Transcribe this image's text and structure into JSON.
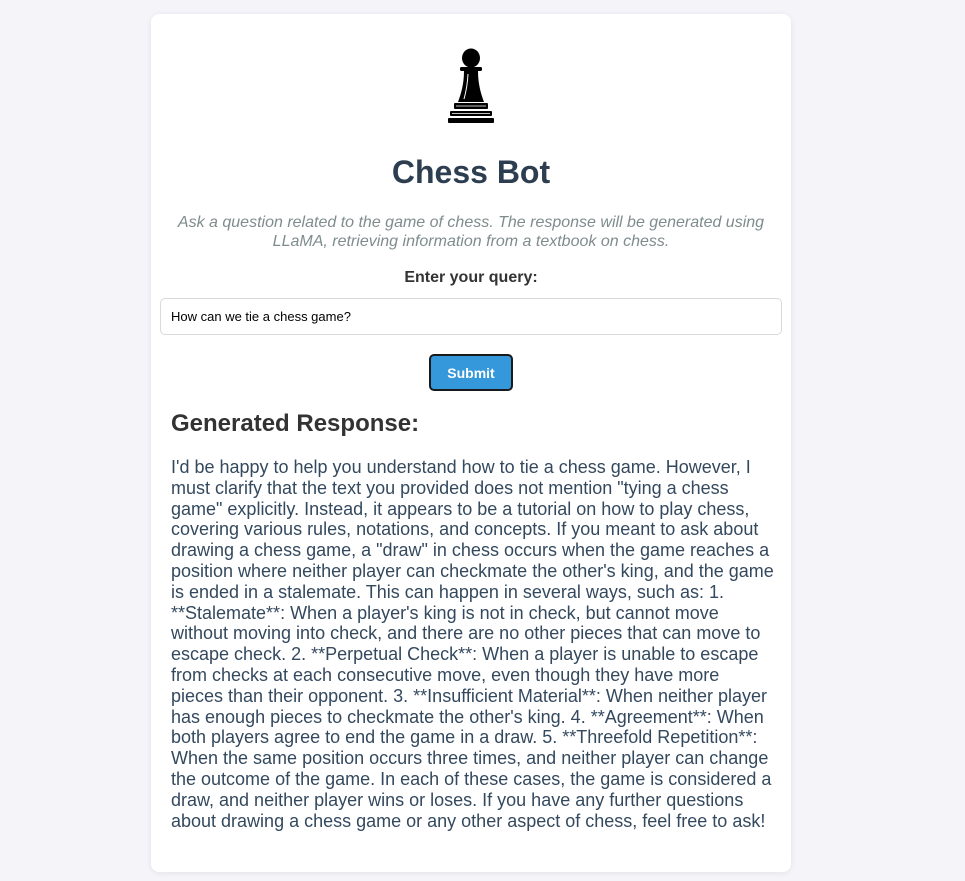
{
  "header": {
    "logo_icon": "chess-pawn-icon",
    "title": "Chess Bot",
    "subtitle": "Ask a question related to the game of chess. The response will be generated using LLaMA, retrieving information from a textbook on chess."
  },
  "query": {
    "label": "Enter your query:",
    "value": "How can we tie a chess game?"
  },
  "submit": {
    "label": "Submit"
  },
  "response": {
    "heading": "Generated Response:",
    "text": "I'd be happy to help you understand how to tie a chess game. However, I must clarify that the text you provided does not mention \"tying a chess game\" explicitly. Instead, it appears to be a tutorial on how to play chess, covering various rules, notations, and concepts. If you meant to ask about drawing a chess game, a \"draw\" in chess occurs when the game reaches a position where neither player can checkmate the other's king, and the game is ended in a stalemate. This can happen in several ways, such as: 1. **Stalemate**: When a player's king is not in check, but cannot move without moving into check, and there are no other pieces that can move to escape check. 2. **Perpetual Check**: When a player is unable to escape from checks at each consecutive move, even though they have more pieces than their opponent. 3. **Insufficient Material**: When neither player has enough pieces to checkmate the other's king. 4. **Agreement**: When both players agree to end the game in a draw. 5. **Threefold Repetition**: When the same position occurs three times, and neither player can change the outcome of the game. In each of these cases, the game is considered a draw, and neither player wins or loses. If you have any further questions about drawing a chess game or any other aspect of chess, feel free to ask!"
  },
  "colors": {
    "page_background": "#f4f4f9",
    "card_background": "#ffffff",
    "title": "#2c3e50",
    "subtitle": "#7f8c8d",
    "button": "#3498db",
    "response_text": "#34495e"
  }
}
